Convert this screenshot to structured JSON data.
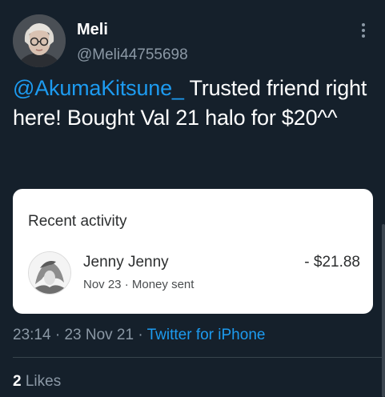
{
  "tweet": {
    "author": {
      "display_name": "Meli",
      "handle": "@Meli44755698"
    },
    "text": {
      "mention": "@AkumaKitsune_",
      "body": " Trusted friend right here! Bought Val 21 halo for $20^^"
    },
    "card": {
      "title": "Recent activity",
      "transaction": {
        "name": "Jenny Jenny",
        "date": "Nov 23",
        "separator": " · ",
        "type": "Money sent",
        "amount": "- $21.88"
      }
    },
    "meta": {
      "time": "23:14",
      "sep1": " · ",
      "date": "23 Nov 21",
      "sep2": " · ",
      "source": "Twitter for iPhone"
    },
    "likes": {
      "count": "2",
      "label": " Likes"
    }
  },
  "icons": {
    "more": "more-vertical-icon",
    "avatar": "user-avatar",
    "transaction_avatar": "contact-avatar"
  },
  "colors": {
    "background": "#15202b",
    "accent": "#1d9bf0",
    "secondary_text": "#8b98a5",
    "card_bg": "#ffffff"
  }
}
